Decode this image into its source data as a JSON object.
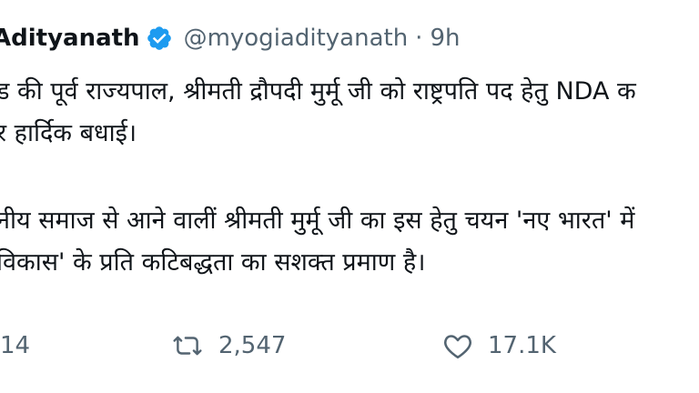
{
  "tweet": {
    "author": {
      "display_name": "Adityanath",
      "handle": "@myogiadityanath",
      "separator": "·",
      "time": "9h",
      "verified_icon": "verified-badge-icon",
      "verified_color": "#1d9bf0"
    },
    "body": {
      "line1": "ड की पूर्व राज्यपाल, श्रीमती द्रौपदी मुर्मू जी को राष्ट्रपति पद हेतु NDA क",
      "line2": "र हार्दिक बधाई।",
      "line3": "नीय समाज से आने वालीं श्रीमती मुर्मू जी का इस हेतु चयन 'नए भारत' में",
      "line4": "विकास' के प्रति कटिबद्धता का सशक्त प्रमाण है।"
    },
    "actions": {
      "reply": {
        "icon": "reply-icon",
        "count": "14"
      },
      "retweet": {
        "icon": "retweet-icon",
        "count": "2,547"
      },
      "like": {
        "icon": "heart-icon",
        "count": "17.1K"
      }
    }
  },
  "colors": {
    "text": "#0f1419",
    "secondary": "#536471",
    "background": "#ffffff"
  }
}
